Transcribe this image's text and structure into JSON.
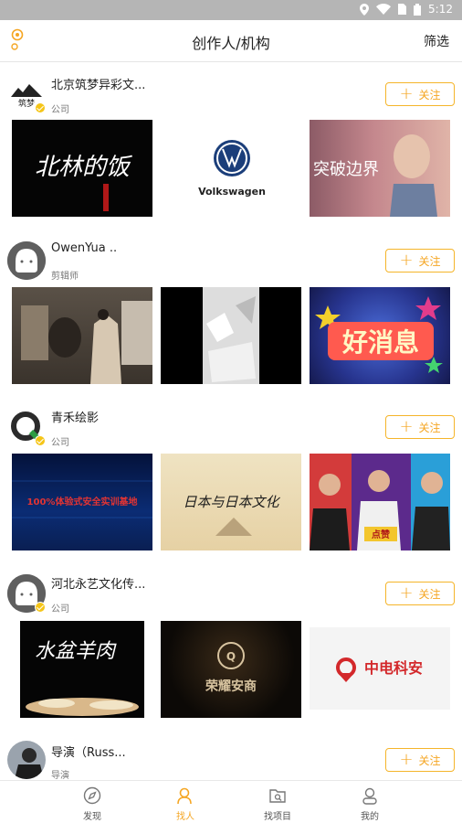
{
  "status_bar": {
    "time": "5:12"
  },
  "header": {
    "title": "创作人/机构",
    "filter_label": "筛选"
  },
  "follow_label": "关注",
  "creators": [
    {
      "name": "北京筑梦异彩文...",
      "role": "公司",
      "avatar_text": "筑梦",
      "thumbs": [
        {
          "text": "北林的饭"
        },
        {
          "text": "Volkswagen"
        },
        {
          "text": "突破边界"
        }
      ]
    },
    {
      "name": "OwenYua ..",
      "role": "剪辑师",
      "thumbs": [
        {
          "text": ""
        },
        {
          "text": ""
        },
        {
          "text": "好消息"
        }
      ]
    },
    {
      "name": "青禾绘影",
      "role": "公司",
      "thumbs": [
        {
          "text": "100%体验式安全实训基地"
        },
        {
          "text": "日本与日本文化"
        },
        {
          "text": "点赞"
        }
      ]
    },
    {
      "name": "河北永艺文化传...",
      "role": "公司",
      "thumbs": [
        {
          "text": "水盆羊肉"
        },
        {
          "text": "荣耀安商"
        },
        {
          "text": "中电科安"
        }
      ]
    },
    {
      "name": "导演（Russ...",
      "role": "导演"
    }
  ],
  "tabs": [
    {
      "label": "发现",
      "icon": "discover-icon"
    },
    {
      "label": "找人",
      "icon": "find-people-icon",
      "active": true
    },
    {
      "label": "找项目",
      "icon": "find-project-icon"
    },
    {
      "label": "我的",
      "icon": "profile-icon"
    }
  ],
  "colors": {
    "accent": "#f5a623",
    "status_bar": "#b5b5b5"
  }
}
